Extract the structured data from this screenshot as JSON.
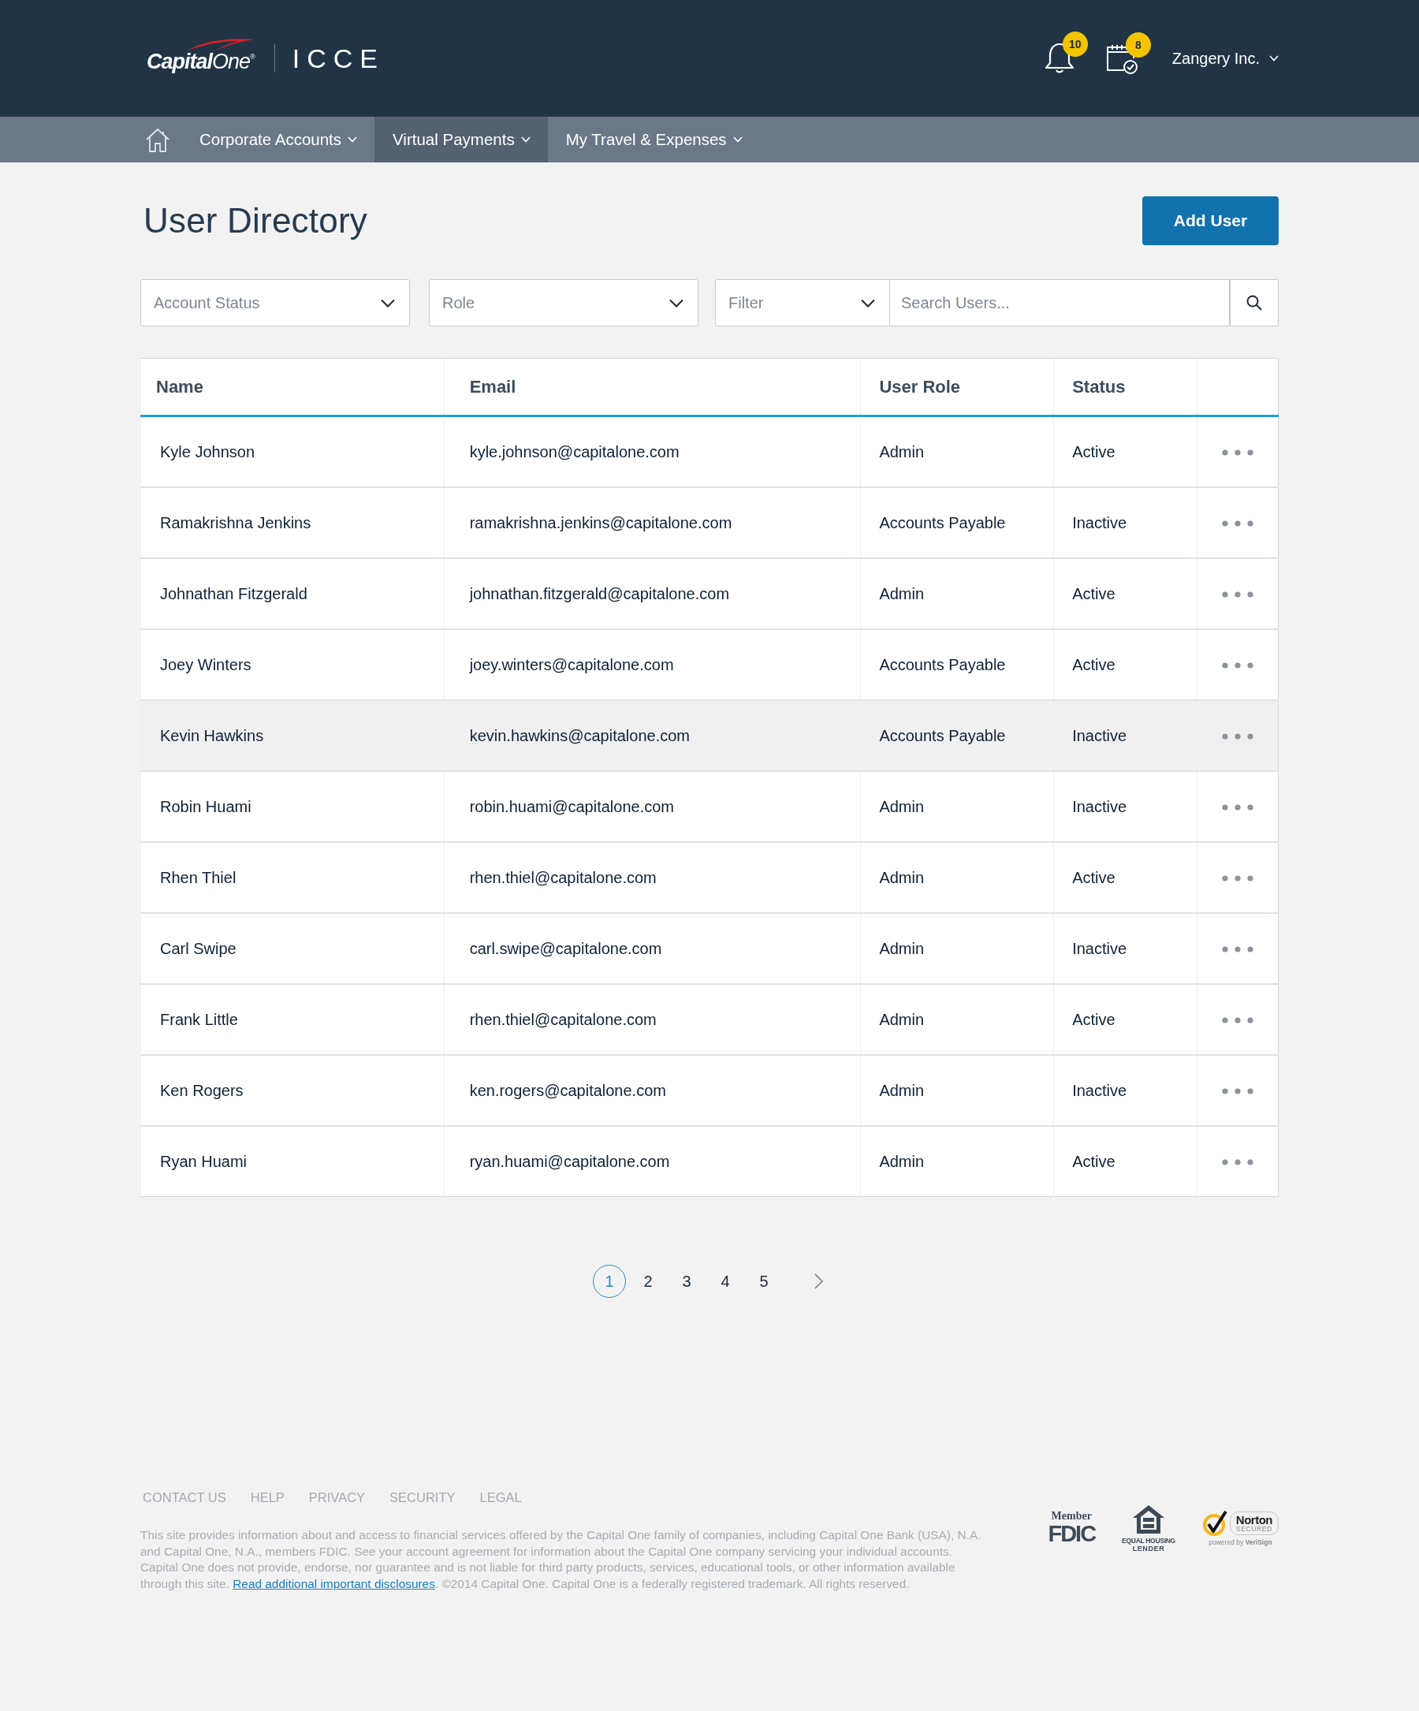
{
  "header": {
    "logo_text": "**Capital**One$^{®}$",
    "app_name": "ICCE",
    "notifications": {
      "count": "10"
    },
    "tasks": {
      "count": "8"
    },
    "account": {
      "label": "Zangery Inc."
    }
  },
  "nav": {
    "items": [
      {
        "label": "Corporate Accounts",
        "selected": false
      },
      {
        "label": "Virtual Payments",
        "selected": true
      },
      {
        "label": "My Travel & Expenses",
        "selected": false
      }
    ]
  },
  "page": {
    "title": "User Directory",
    "add_button": "Add User"
  },
  "filters": {
    "dropdowns": [
      {
        "placeholder": "Account Status"
      },
      {
        "placeholder": "Role"
      },
      {
        "placeholder": "Filter"
      }
    ],
    "search": {
      "placeholder": "Search Users..."
    }
  },
  "table": {
    "columns": [
      "Name",
      "Email",
      "User Role",
      "Status"
    ],
    "rows": [
      {
        "name": "Kyle Johnson",
        "email": "kyle.johnson@capitalone.com",
        "role": "Admin",
        "status": "Active",
        "selected": false
      },
      {
        "name": "Ramakrishna Jenkins",
        "email": "ramakrishna.jenkins@capitalone.com",
        "role": "Accounts Payable",
        "status": "Inactive",
        "selected": false
      },
      {
        "name": "Johnathan Fitzgerald",
        "email": "johnathan.fitzgerald@capitalone.com",
        "role": "Admin",
        "status": "Active",
        "selected": false
      },
      {
        "name": "Joey Winters",
        "email": "joey.winters@capitalone.com",
        "role": "Accounts Payable",
        "status": "Active",
        "selected": false
      },
      {
        "name": "Kevin Hawkins",
        "email": "kevin.hawkins@capitalone.com",
        "role": "Accounts Payable",
        "status": "Inactive",
        "selected": true
      },
      {
        "name": "Robin Huami",
        "email": "robin.huami@capitalone.com",
        "role": "Admin",
        "status": "Inactive",
        "selected": false
      },
      {
        "name": "Rhen Thiel",
        "email": "rhen.thiel@capitalone.com",
        "role": "Admin",
        "status": "Active",
        "selected": false
      },
      {
        "name": "Carl Swipe",
        "email": "carl.swipe@capitalone.com",
        "role": "Admin",
        "status": "Inactive",
        "selected": false
      },
      {
        "name": "Frank Little",
        "email": "rhen.thiel@capitalone.com",
        "role": "Admin",
        "status": "Active",
        "selected": false
      },
      {
        "name": "Ken Rogers",
        "email": "ken.rogers@capitalone.com",
        "role": "Admin",
        "status": "Inactive",
        "selected": false
      },
      {
        "name": "Ryan Huami",
        "email": "ryan.huami@capitalone.com",
        "role": "Admin",
        "status": "Active",
        "selected": false
      }
    ]
  },
  "pagination": {
    "pages": [
      {
        "label": "1",
        "selected": true
      },
      {
        "label": "2",
        "selected": false
      },
      {
        "label": "3",
        "selected": false
      },
      {
        "label": "4",
        "selected": false
      },
      {
        "label": "5",
        "selected": false
      }
    ]
  },
  "footer": {
    "links": [
      "CONTACT US",
      "HELP",
      "PRIVACY",
      "SECURITY",
      "LEGAL"
    ],
    "disclaimer": {
      "before": "This site provides information about and access to financial services offered by the Capital One family of companies, including Capital One Bank (USA), N.A. and Capital One, N.A., members FDIC. See your account agreement for information about the Capital One company servicing your individual accounts. Capital One does not provide, endorse, nor guarantee and is not liable for third party products, services, educational tools, or other information available through this site. ",
      "link": "Read additional important disclosures",
      "after": ". ©2014 Capital One. Capital One is a federally registered trademark. All rights reserved."
    },
    "seals": [
      {
        "kind": "fdic",
        "texts": [
          "Member",
          "FDIC"
        ]
      },
      {
        "kind": "housing",
        "texts": [
          "EQUAL HOUSING",
          "LENDER"
        ]
      },
      {
        "kind": "norton",
        "texts": [
          "Norton",
          "SECURED",
          "powered by **VeriSign**"
        ]
      }
    ]
  }
}
